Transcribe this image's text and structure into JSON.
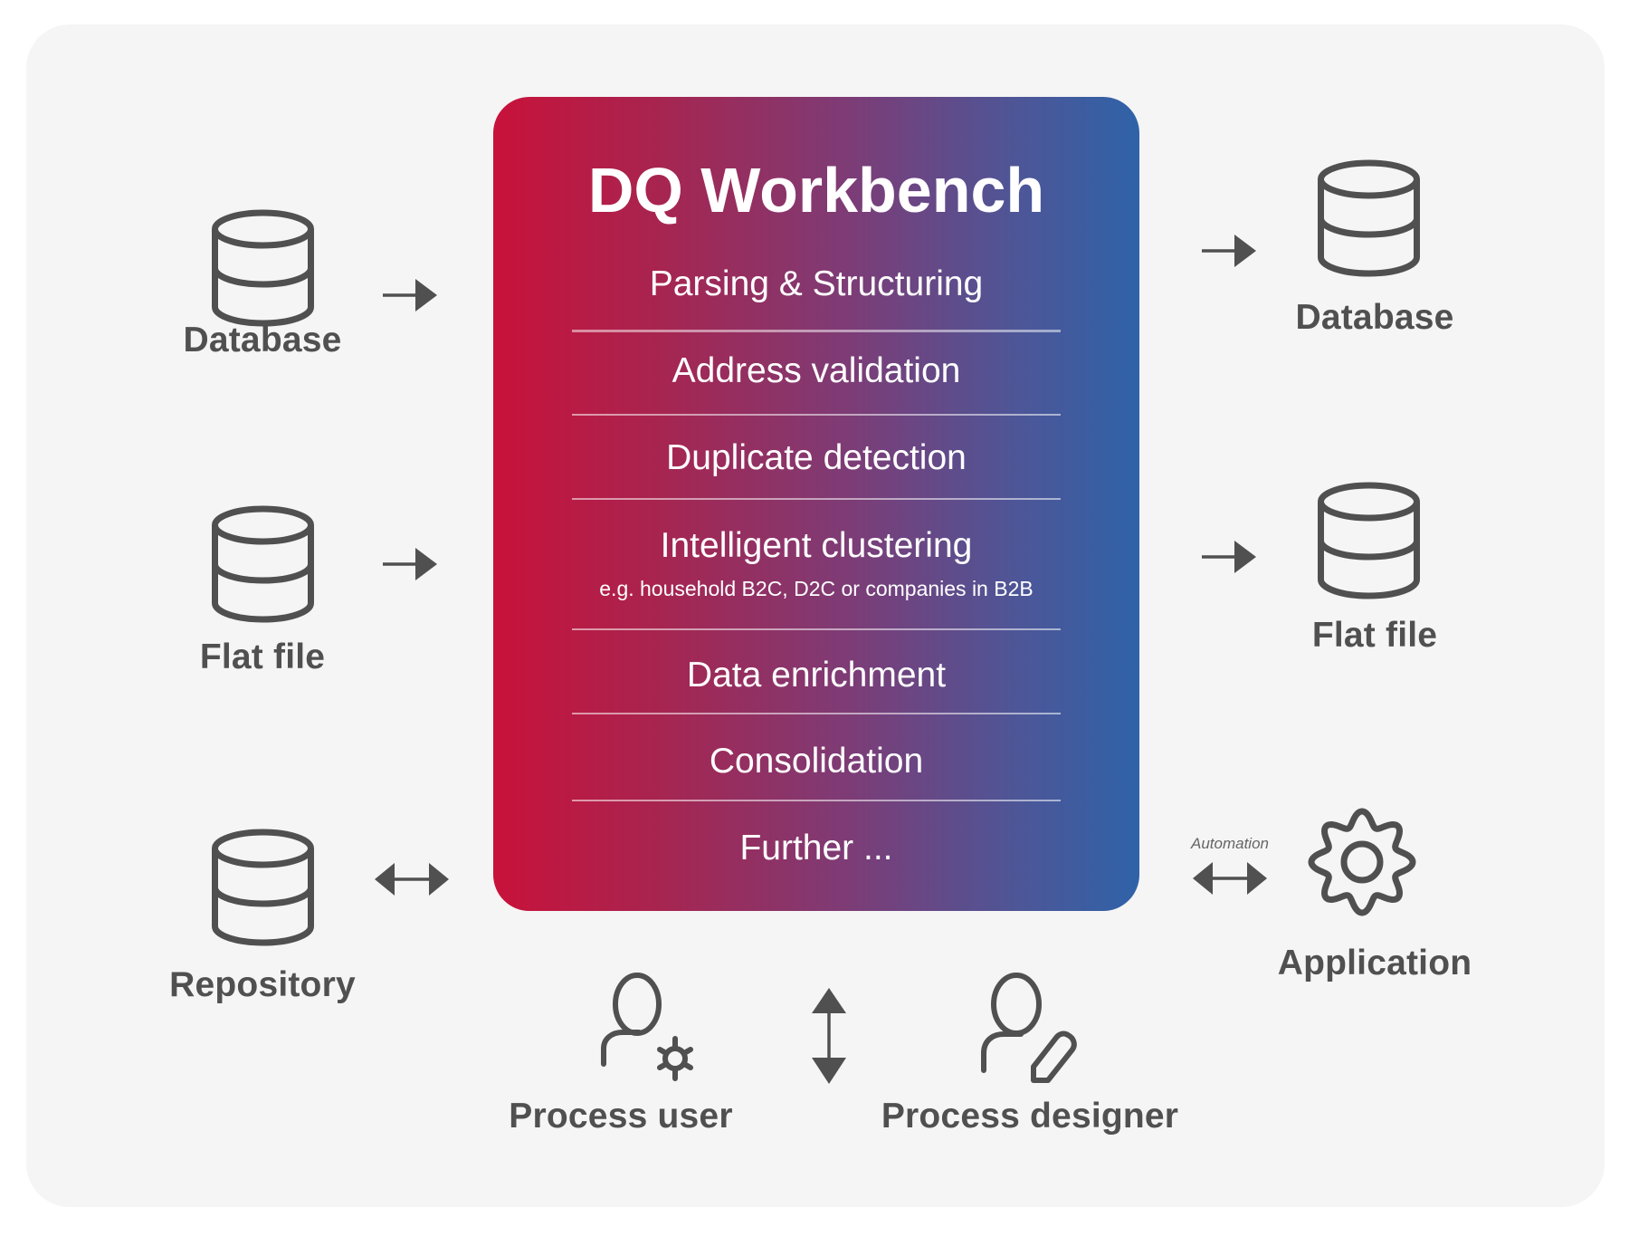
{
  "workbench": {
    "title": "DQ Workbench",
    "gradient_start": "#c8123a",
    "gradient_end": "#2f62a8",
    "items": [
      {
        "label": "Parsing & Structuring"
      },
      {
        "label": "Address validation"
      },
      {
        "label": "Duplicate detection"
      },
      {
        "label": "Intelligent clustering",
        "sublabel": "e.g. household B2C, D2C or companies in B2B"
      },
      {
        "label": "Data enrichment"
      },
      {
        "label": "Consolidation"
      },
      {
        "label": "Further ..."
      }
    ]
  },
  "inputs": [
    {
      "label": "Database",
      "icon": "database-icon",
      "connector": "arrow-right"
    },
    {
      "label": "Flat file",
      "icon": "database-icon",
      "connector": "arrow-right"
    },
    {
      "label": "Repository",
      "icon": "database-icon",
      "connector": "arrow-bidirectional"
    }
  ],
  "outputs": [
    {
      "label": "Database",
      "icon": "database-icon",
      "connector": "arrow-right"
    },
    {
      "label": "Flat file",
      "icon": "database-icon",
      "connector": "arrow-right"
    },
    {
      "label": "Application",
      "icon": "gear-icon",
      "connector": "arrow-bidirectional",
      "connector_label": "Automation"
    }
  ],
  "roles": [
    {
      "label": "Process user",
      "icon": "user-settings-icon"
    },
    {
      "label": "Process designer",
      "icon": "user-edit-icon"
    }
  ],
  "roles_connector": "arrow-vertical-bidirectional",
  "icon_color": "#505050",
  "panel_color": "#f5f5f5"
}
